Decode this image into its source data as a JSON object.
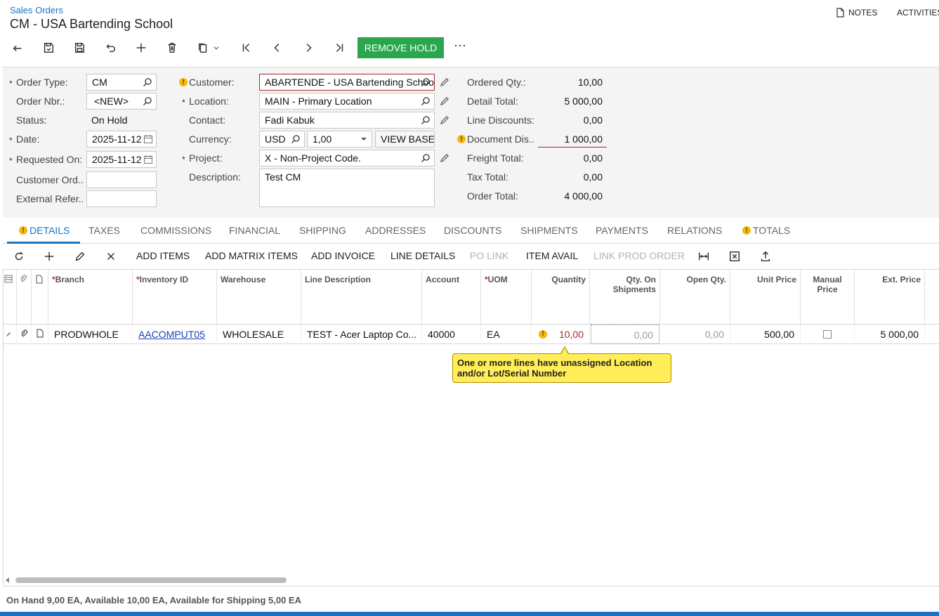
{
  "header": {
    "breadcrumb": "Sales Orders",
    "title": "CM - USA Bartending School",
    "notes_label": "NOTES",
    "activities_label": "ACTIVITIES"
  },
  "toolbar": {
    "remove_hold_label": "REMOVE HOLD",
    "more_label": "⋯"
  },
  "form": {
    "order_type": {
      "label": "Order Type:",
      "value": "CM"
    },
    "order_nbr": {
      "label": "Order Nbr.:",
      "value": "<NEW>"
    },
    "status": {
      "label": "Status:",
      "value": "On Hold"
    },
    "date": {
      "label": "Date:",
      "value": "2025-11-12"
    },
    "requested_on": {
      "label": "Requested On:",
      "value": "2025-11-12"
    },
    "customer_ord": {
      "label": "Customer Ord...",
      "value": ""
    },
    "external_ref": {
      "label": "External Refer...",
      "value": ""
    },
    "customer": {
      "label": "Customer:",
      "value": "ABARTENDE - USA Bartending School"
    },
    "location": {
      "label": "Location:",
      "value": "MAIN - Primary Location"
    },
    "contact": {
      "label": "Contact:",
      "value": "Fadi Kabuk"
    },
    "currency": {
      "label": "Currency:",
      "value": "USD",
      "rate": "1,00",
      "view_base_label": "VIEW BASE"
    },
    "project": {
      "label": "Project:",
      "value": "X - Non-Project Code."
    },
    "description": {
      "label": "Description:",
      "value": "Test CM"
    }
  },
  "totals": [
    {
      "label": "Ordered Qty.:",
      "value": "10,00",
      "warn": false,
      "error": false
    },
    {
      "label": "Detail Total:",
      "value": "5 000,00",
      "warn": false,
      "error": false
    },
    {
      "label": "Line Discounts:",
      "value": "0,00",
      "warn": false,
      "error": false
    },
    {
      "label": "Document Dis...",
      "value": "1 000,00",
      "warn": true,
      "error": true
    },
    {
      "label": "Freight Total:",
      "value": "0,00",
      "warn": false,
      "error": false
    },
    {
      "label": "Tax Total:",
      "value": "0,00",
      "warn": false,
      "error": false
    },
    {
      "label": "Order Total:",
      "value": "4 000,00",
      "warn": false,
      "error": false
    }
  ],
  "tabs": [
    {
      "label": "DETAILS",
      "warn": true,
      "active": true
    },
    {
      "label": "TAXES"
    },
    {
      "label": "COMMISSIONS"
    },
    {
      "label": "FINANCIAL"
    },
    {
      "label": "SHIPPING"
    },
    {
      "label": "ADDRESSES"
    },
    {
      "label": "DISCOUNTS"
    },
    {
      "label": "SHIPMENTS"
    },
    {
      "label": "PAYMENTS"
    },
    {
      "label": "RELATIONS"
    },
    {
      "label": "TOTALS",
      "warn": true
    }
  ],
  "grid_toolbar": {
    "add_items": "ADD ITEMS",
    "add_matrix_items": "ADD MATRIX ITEMS",
    "add_invoice": "ADD INVOICE",
    "line_details": "LINE DETAILS",
    "po_link": "PO LINK",
    "item_avail": "ITEM AVAIL",
    "link_prod_order": "LINK PROD ORDER"
  },
  "grid": {
    "columns": {
      "branch": "Branch",
      "inventory_id": "Inventory ID",
      "warehouse": "Warehouse",
      "line_description": "Line Description",
      "account": "Account",
      "uom": "UOM",
      "quantity": "Quantity",
      "qty_on_shipments": "Qty. On Shipments",
      "open_qty": "Open Qty.",
      "unit_price": "Unit Price",
      "manual_price": "Manual Price",
      "ext_price": "Ext. Price"
    },
    "rows": [
      {
        "branch": "PRODWHOLE",
        "inventory_id": "AACOMPUT05",
        "warehouse": "WHOLESALE",
        "line_description": "TEST - Acer Laptop Co...",
        "account": "40000",
        "uom": "EA",
        "quantity": "10,00",
        "qty_on_shipments": "0,00",
        "open_qty": "0,00",
        "unit_price": "500,00",
        "manual_price": false,
        "ext_price": "5 000,00"
      }
    ]
  },
  "tooltip": "One or more lines have unassigned Location and/or Lot/Serial Number",
  "status_bar": "On Hand 9,00 EA, Available 10,00 EA, Available for Shipping 5,00 EA",
  "colors": {
    "accent": "#1a73c2",
    "remove_hold": "#2aa74e",
    "warning": "#f2b90f",
    "error": "#a52a2a",
    "tooltip": "#ffee58"
  }
}
